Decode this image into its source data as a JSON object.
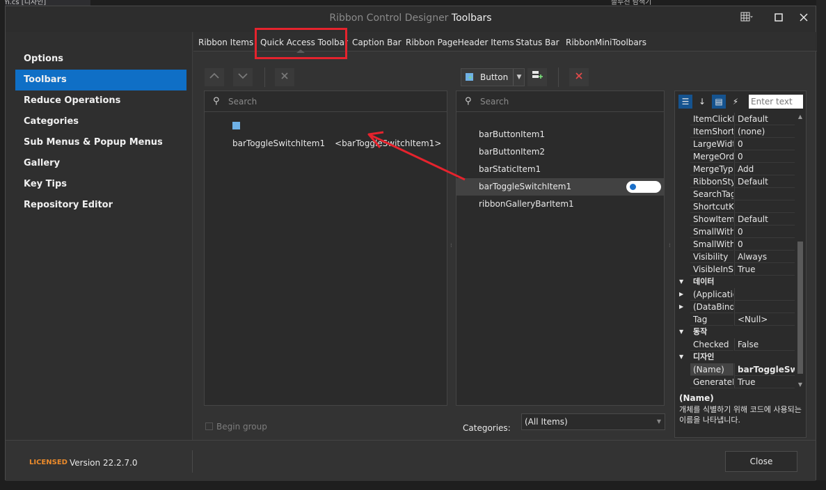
{
  "background": {
    "left_tab_text": "m.cs [디자인]",
    "right_tab_text": "솔루션 탐색기"
  },
  "window": {
    "title_dim": "Ribbon Control Designer",
    "title_bright": "Toolbars"
  },
  "nav": {
    "items": [
      {
        "label": "Options"
      },
      {
        "label": "Toolbars"
      },
      {
        "label": "Reduce Operations"
      },
      {
        "label": "Categories"
      },
      {
        "label": "Sub Menus & Popup Menus"
      },
      {
        "label": "Gallery"
      },
      {
        "label": "Key Tips"
      },
      {
        "label": "Repository Editor"
      }
    ],
    "selected": "Toolbars"
  },
  "tabs": [
    {
      "label": "Ribbon Items"
    },
    {
      "label": "Quick Access Toolbar"
    },
    {
      "label": "Caption Bar"
    },
    {
      "label": "Ribbon PageHeader Items"
    },
    {
      "label": "Status Bar"
    },
    {
      "label": "RibbonMiniToolbars"
    }
  ],
  "active_tab": "Quick Access Toolbar",
  "left_panel": {
    "search_placeholder": "Search",
    "items": [
      {
        "label": "barToggleSwitchItem1",
        "caption": "<barToggleSwitchItem1>"
      }
    ],
    "begin_group_label": "Begin group"
  },
  "right_panel": {
    "add_button_label": "Button",
    "search_placeholder": "Search",
    "items": [
      {
        "label": "barButtonItem1"
      },
      {
        "label": "barButtonItem2"
      },
      {
        "label": "barStaticItem1"
      },
      {
        "label": "barToggleSwitchItem1"
      },
      {
        "label": "ribbonGalleryBarItem1"
      }
    ],
    "categories_label": "Categories:",
    "categories_value": "(All Items)"
  },
  "properties": {
    "search_placeholder": "Enter text",
    "rows": [
      {
        "k": "ItemClickFi",
        "v": "Default"
      },
      {
        "k": "ItemShortc",
        "v": "(none)"
      },
      {
        "k": "LargeWidtl",
        "v": "0"
      },
      {
        "k": "MergeOrde",
        "v": "0"
      },
      {
        "k": "MergeType",
        "v": "Add"
      },
      {
        "k": "RibbonStyl",
        "v": "Default"
      },
      {
        "k": "SearchTag",
        "v": ""
      },
      {
        "k": "ShortcutKe",
        "v": ""
      },
      {
        "k": "ShowItem",
        "v": "Default"
      },
      {
        "k": "SmallWithc",
        "v": "0"
      },
      {
        "k": "SmallWithT",
        "v": "0"
      },
      {
        "k": "Visibility",
        "v": "Always"
      },
      {
        "k": "VisibleInSe",
        "v": "True"
      }
    ],
    "cat_data": "데이터",
    "data_rows": [
      {
        "k": "(Applicatio",
        "v": ""
      },
      {
        "k": "(DataBindin",
        "v": ""
      },
      {
        "k": "Tag",
        "v": "<Null>"
      }
    ],
    "cat_behavior": "동작",
    "behavior_rows": [
      {
        "k": "Checked",
        "v": "False"
      }
    ],
    "cat_design": "디자인",
    "design_rows": [
      {
        "k": "(Name)",
        "v": "barToggleSw"
      },
      {
        "k": "GenerateM",
        "v": "True"
      }
    ],
    "desc_title": "(Name)",
    "desc_text": "개체를 식별하기 위해 코드에 사용되는 이름을 나타냅니다."
  },
  "footer": {
    "license": "LICENSED",
    "version": "Version 22.2.7.0",
    "close_label": "Close"
  },
  "colors": {
    "accent": "#0f6fc6",
    "highlight_red": "#e5232d",
    "license_orange": "#ec8b2b"
  }
}
